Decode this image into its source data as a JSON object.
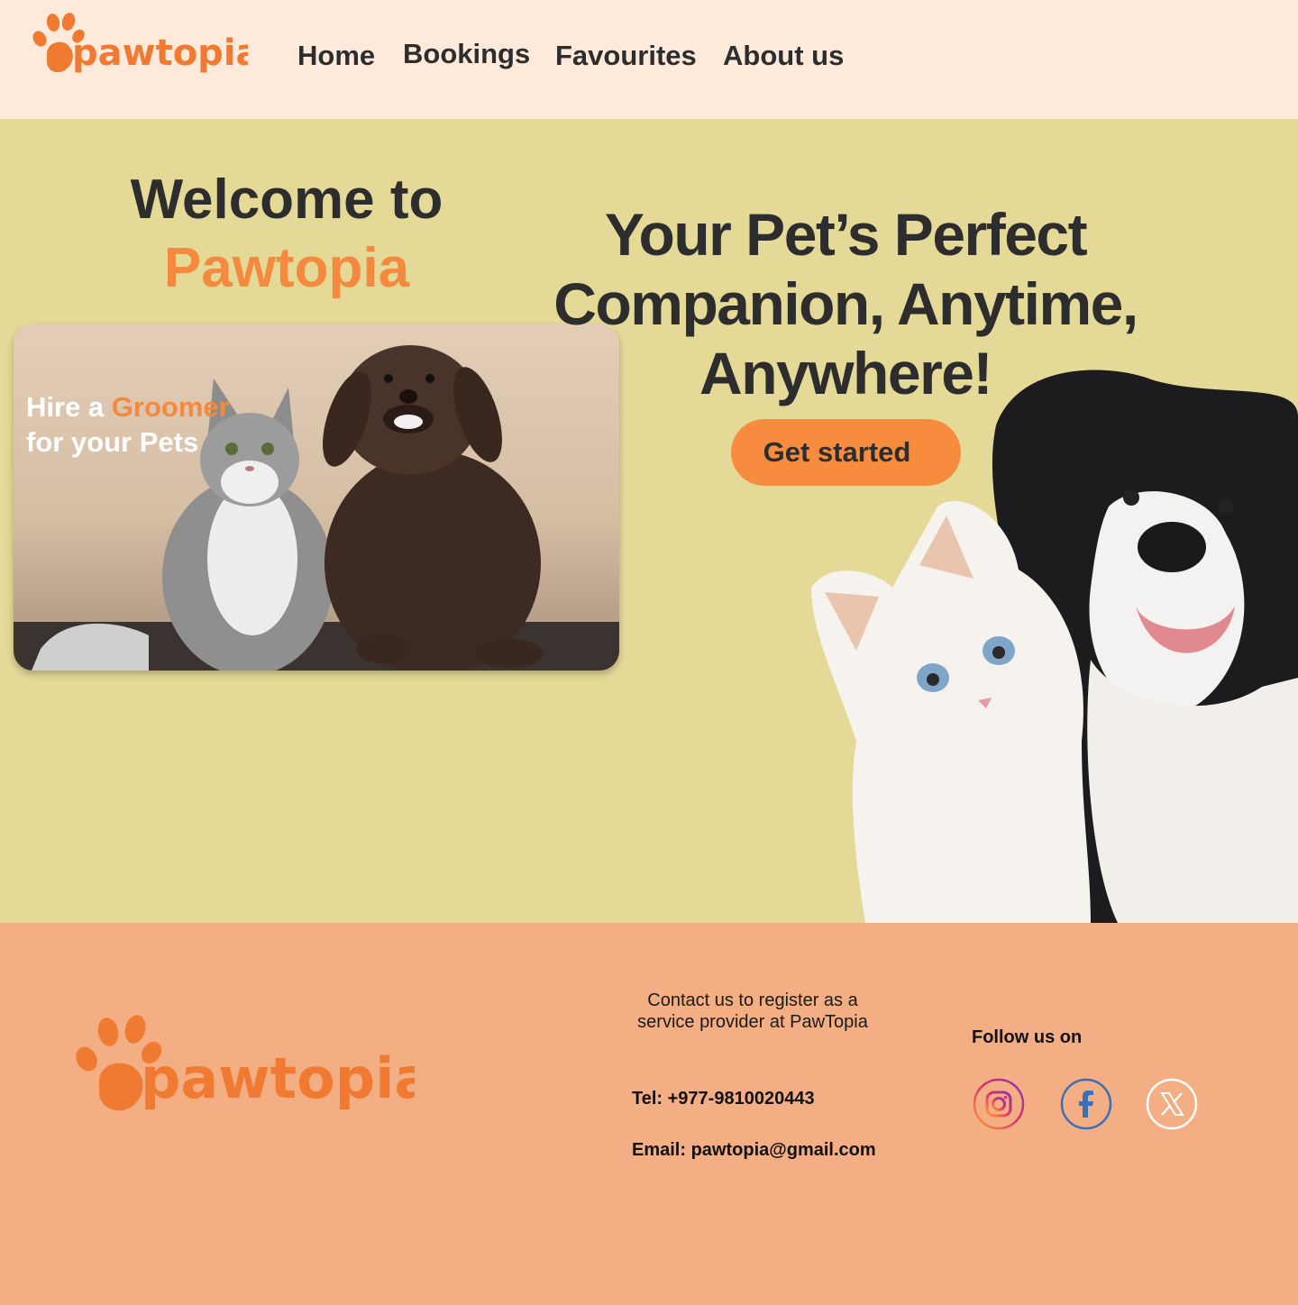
{
  "nav": {
    "logo_text": "pawtopia",
    "links": [
      "Home",
      "Bookings",
      "Favourites",
      "About us"
    ]
  },
  "hero": {
    "welcome_line": "Welcome to",
    "brand_line": "Pawtopia",
    "card": {
      "line1_prefix": "Hire a ",
      "line1_highlight": "Groomer",
      "line2": "for your Pets"
    },
    "tagline": "Your Pet’s Perfect Companion, Anytime, Anywhere!",
    "cta_label": "Get started"
  },
  "footer": {
    "logo_text": "pawtopia",
    "contact_note": "Contact us to register as a service provider at PawTopia",
    "tel": "Tel: +977-9810020443",
    "email": "Email: pawtopia@gmail.com",
    "follow_label": "Follow us on",
    "social_icons": [
      "instagram-icon",
      "facebook-icon",
      "x-icon"
    ]
  },
  "colors": {
    "accent": "#f58a3e",
    "nav_bg": "#fdeadb",
    "hero_bg": "#e5d998",
    "footer_bg": "#f4ae84",
    "text": "#2d2d2d"
  }
}
